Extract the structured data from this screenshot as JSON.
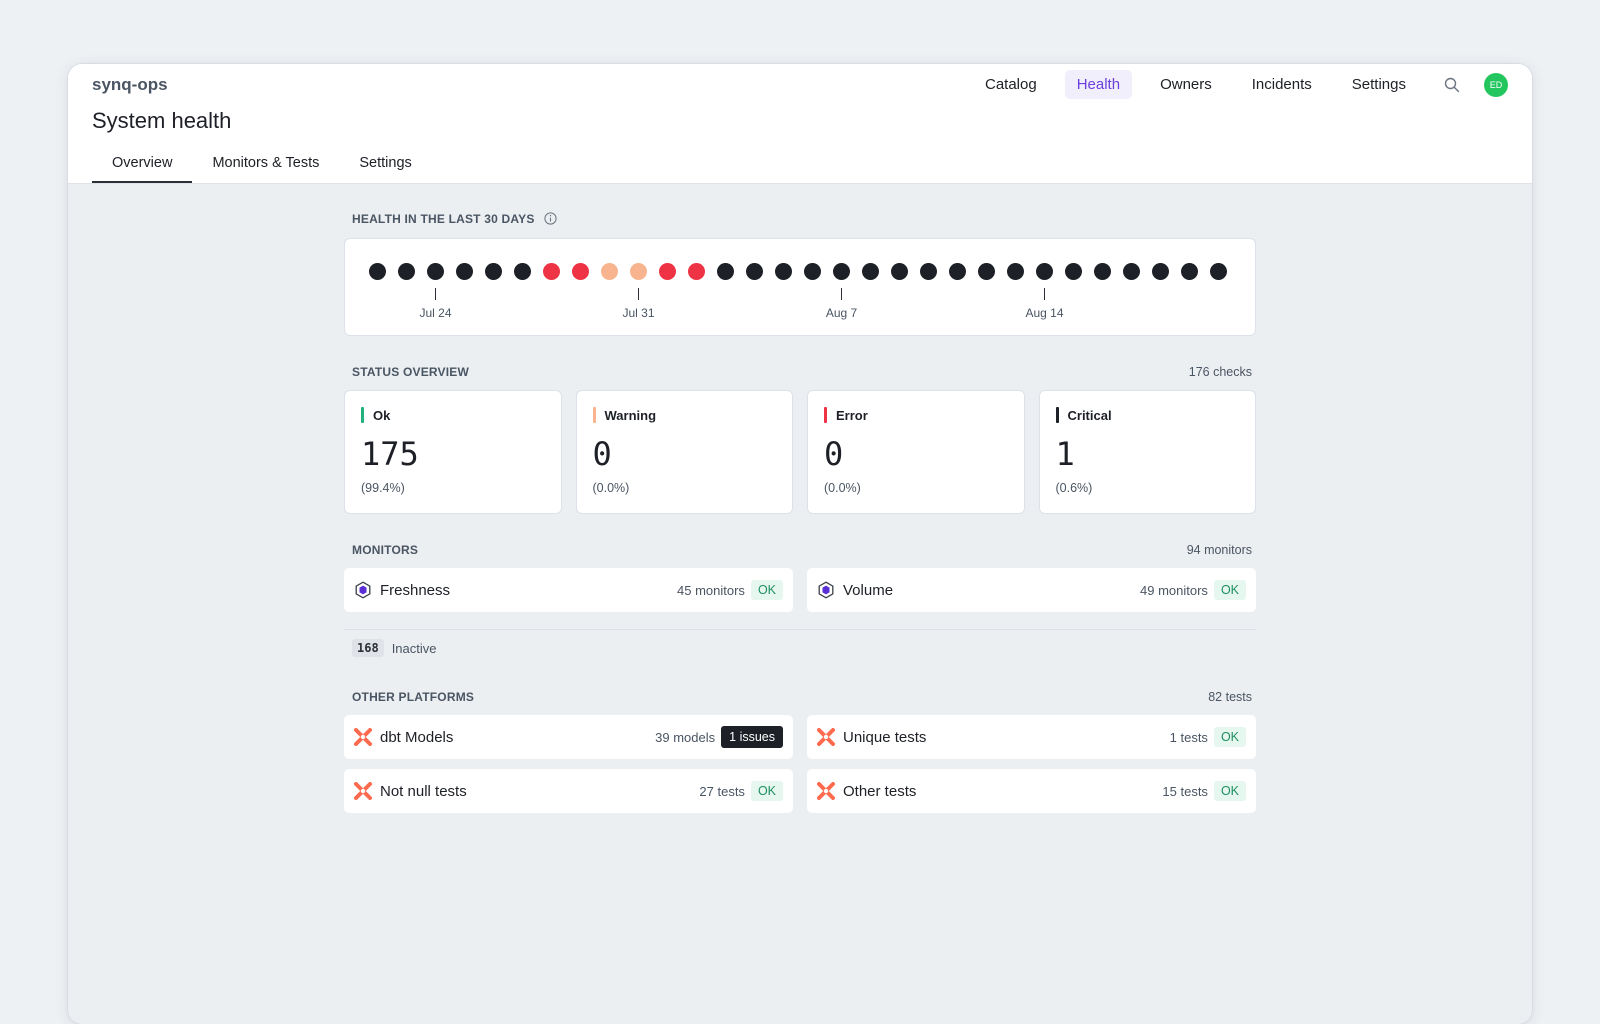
{
  "app": {
    "brand": "synq-ops",
    "page_title": "System health"
  },
  "nav": {
    "items": [
      {
        "label": "Catalog",
        "active": false
      },
      {
        "label": "Health",
        "active": true
      },
      {
        "label": "Owners",
        "active": false
      },
      {
        "label": "Incidents",
        "active": false
      },
      {
        "label": "Settings",
        "active": false
      }
    ],
    "search_icon": "search-icon",
    "avatar_initials": "ED"
  },
  "tabs": [
    {
      "label": "Overview",
      "active": true
    },
    {
      "label": "Monitors & Tests",
      "active": false
    },
    {
      "label": "Settings",
      "active": false
    }
  ],
  "health_timeline": {
    "title": "HEALTH IN THE LAST 30 DAYS",
    "days": [
      "critical",
      "critical",
      "critical",
      "critical",
      "critical",
      "critical",
      "error",
      "error",
      "warning",
      "warning",
      "error",
      "error",
      "critical",
      "critical",
      "critical",
      "critical",
      "critical",
      "critical",
      "critical",
      "critical",
      "critical",
      "critical",
      "critical",
      "critical",
      "critical",
      "critical",
      "critical",
      "critical",
      "critical",
      "critical"
    ],
    "ticks": [
      {
        "label": "Jul 24",
        "day_index": 2
      },
      {
        "label": "Jul 31",
        "day_index": 9
      },
      {
        "label": "Aug 7",
        "day_index": 16
      },
      {
        "label": "Aug 14",
        "day_index": 23
      }
    ]
  },
  "status_overview": {
    "title": "STATUS OVERVIEW",
    "count_label": "176 checks",
    "cards": [
      {
        "label": "Ok",
        "value": "175",
        "pct": "(99.4%)",
        "color": "#22b07d"
      },
      {
        "label": "Warning",
        "value": "0",
        "pct": "(0.0%)",
        "color": "#f7b48f"
      },
      {
        "label": "Error",
        "value": "0",
        "pct": "(0.0%)",
        "color": "#ee3344"
      },
      {
        "label": "Critical",
        "value": "1",
        "pct": "(0.6%)",
        "color": "#1d2026"
      }
    ]
  },
  "monitors": {
    "title": "MONITORS",
    "count_label": "94 monitors",
    "items": [
      {
        "name": "Freshness",
        "count": "45 monitors",
        "status": "OK"
      },
      {
        "name": "Volume",
        "count": "49 monitors",
        "status": "OK"
      }
    ],
    "inactive_count": "168",
    "inactive_label": "Inactive"
  },
  "other_platforms": {
    "title": "OTHER PLATFORMS",
    "count_label": "82 tests",
    "items": [
      {
        "name": "dbt Models",
        "count": "39 models",
        "status": "1 issues"
      },
      {
        "name": "Unique tests",
        "count": "1 tests",
        "status": "OK"
      },
      {
        "name": "Not null tests",
        "count": "27 tests",
        "status": "OK"
      },
      {
        "name": "Other tests",
        "count": "15 tests",
        "status": "OK"
      }
    ]
  },
  "colors": {
    "critical": "#1d2026",
    "error": "#ee3344",
    "warning": "#f7b48f",
    "ok": "#22b07d",
    "accent": "#6d3fdc"
  }
}
